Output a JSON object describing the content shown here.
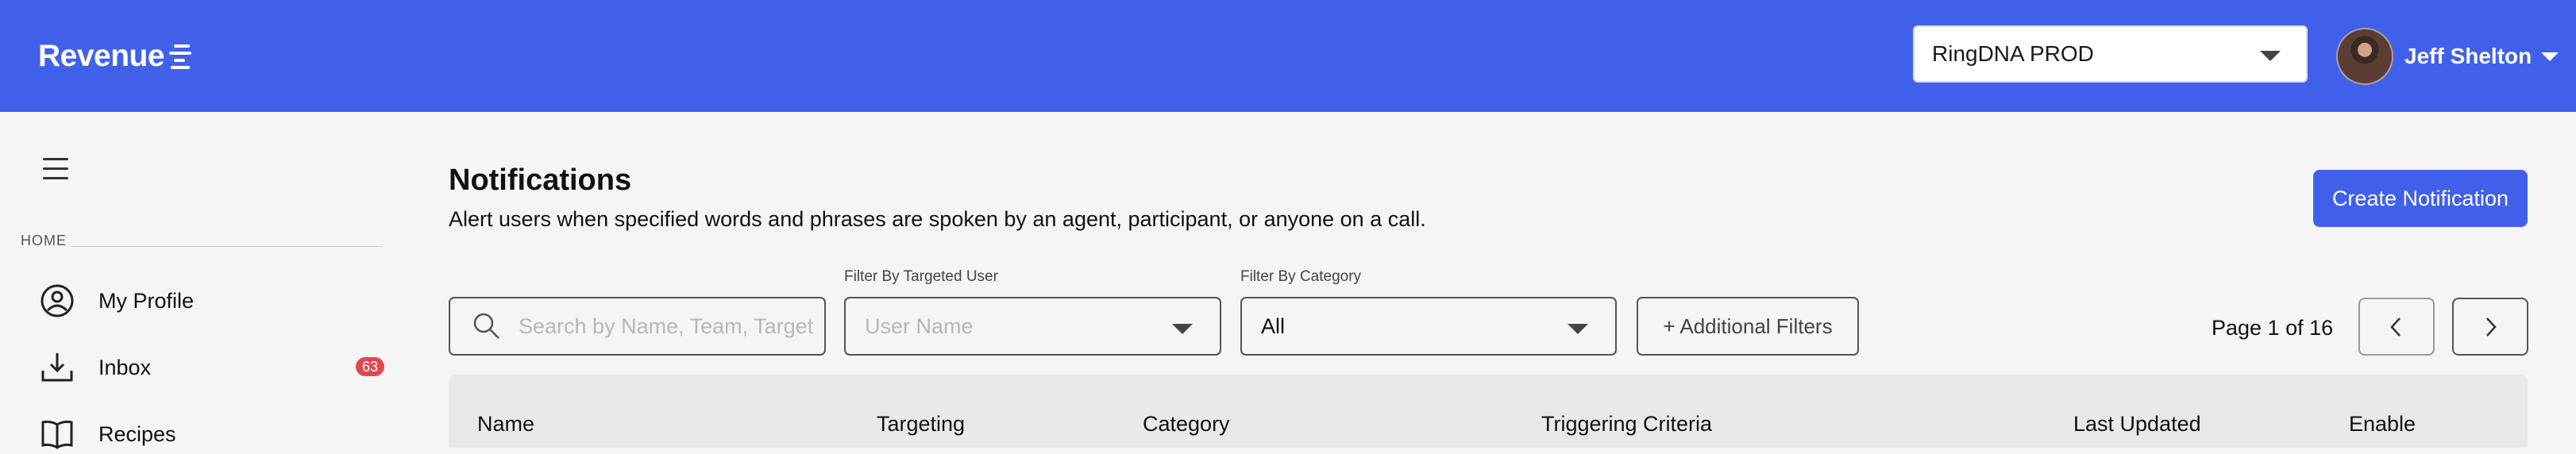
{
  "header": {
    "brand": "Revenue",
    "org_select": "RingDNA PROD",
    "user_name": "Jeff Shelton"
  },
  "sidebar": {
    "section_label": "HOME",
    "items": [
      {
        "label": "My Profile",
        "icon": "user-circle-icon"
      },
      {
        "label": "Inbox",
        "icon": "inbox-icon",
        "badge": "63"
      },
      {
        "label": "Recipes",
        "icon": "book-icon"
      }
    ]
  },
  "main": {
    "title": "Notifications",
    "subtitle": "Alert users when specified words and phrases are spoken by an agent, participant, or anyone on a call.",
    "create_button": "Create Notification",
    "filters": {
      "search_placeholder": "Search by Name, Team, Target",
      "targeted_user_label": "Filter By Targeted User",
      "targeted_user_placeholder": "User Name",
      "category_label": "Filter By Category",
      "category_value": "All",
      "additional_filters": "+ Additional Filters"
    },
    "pagination": {
      "text": "Page 1 of 16"
    },
    "table": {
      "columns": [
        "Name",
        "Targeting",
        "Category",
        "Triggering Criteria",
        "Last Updated",
        "Enable"
      ]
    }
  },
  "colors": {
    "brand": "#4160ea",
    "badge": "#e0484e",
    "background": "#f5f5f5"
  }
}
